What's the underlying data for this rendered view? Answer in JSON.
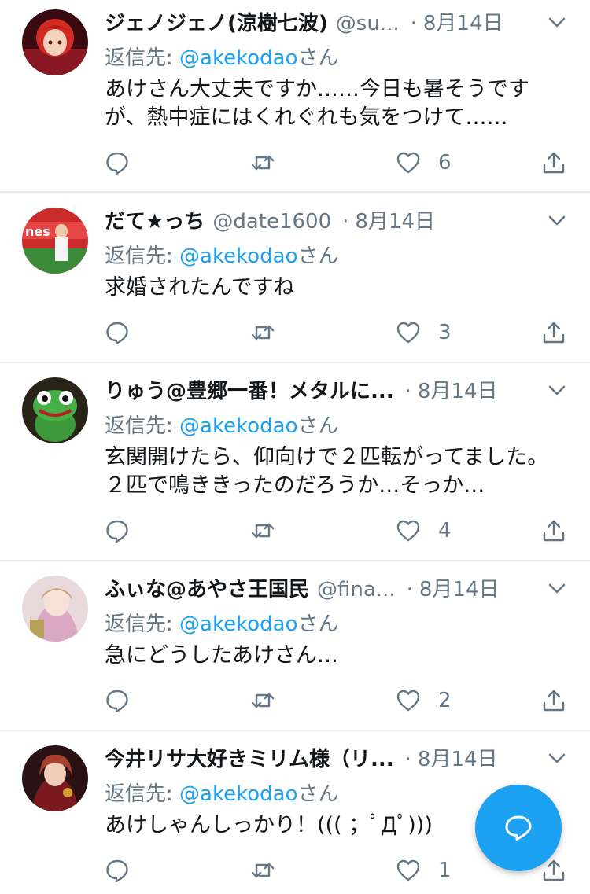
{
  "reply_prefix": "返信先: ",
  "reply_suffix": "さん",
  "separator": "·",
  "tweets": [
    {
      "name": "ジェノジェノ(涼樹七波)",
      "handle": "@su...",
      "date": "8月14日",
      "reply_to": "@akekodao",
      "text": "あけさん大丈夫ですか……今日も暑そうです\nが、熱中症にはくれぐれも気をつけて……",
      "likes": "6"
    },
    {
      "name": "だて★っち",
      "handle": "@date1600",
      "date": "8月14日",
      "reply_to": "@akekodao",
      "text": "求婚されたんですね",
      "likes": "3"
    },
    {
      "name": "りゅう@豊郷一番！メタルに...",
      "handle": "",
      "date": "8月14日",
      "reply_to": "@akekodao",
      "text": "玄関開けたら、仰向けで２匹転がってました。\n２匹で鳴ききったのだろうか…そっか…",
      "likes": "4"
    },
    {
      "name": "ふぃな@あやさ王国民",
      "handle": "@fina...",
      "date": "8月14日",
      "reply_to": "@akekodao",
      "text": "急にどうしたあけさん…",
      "likes": "2"
    },
    {
      "name": "今井リサ大好きミリム様（リ...",
      "handle": "",
      "date": "8月14日",
      "reply_to": "@akekodao",
      "text": "あけしゃんしっかり！((( ；ﾟДﾟ)))",
      "likes": "1"
    }
  ],
  "colors": {
    "accent": "#1da1f2",
    "secondary_text": "#657786",
    "primary_text": "#14171a",
    "divider": "#e6ecf0"
  },
  "icons": {
    "reply": "reply-icon",
    "retweet": "retweet-icon",
    "like": "heart-icon",
    "share": "share-icon",
    "more": "chevron-down-icon",
    "compose": "compose-reply-icon"
  }
}
